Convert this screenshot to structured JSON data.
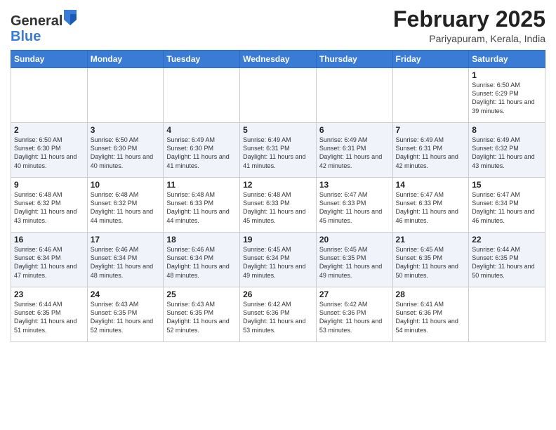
{
  "logo": {
    "general": "General",
    "blue": "Blue"
  },
  "header": {
    "month": "February 2025",
    "location": "Pariyapuram, Kerala, India"
  },
  "weekdays": [
    "Sunday",
    "Monday",
    "Tuesday",
    "Wednesday",
    "Thursday",
    "Friday",
    "Saturday"
  ],
  "weeks": [
    [
      {
        "day": "",
        "sunrise": "",
        "sunset": "",
        "daylight": ""
      },
      {
        "day": "",
        "sunrise": "",
        "sunset": "",
        "daylight": ""
      },
      {
        "day": "",
        "sunrise": "",
        "sunset": "",
        "daylight": ""
      },
      {
        "day": "",
        "sunrise": "",
        "sunset": "",
        "daylight": ""
      },
      {
        "day": "",
        "sunrise": "",
        "sunset": "",
        "daylight": ""
      },
      {
        "day": "",
        "sunrise": "",
        "sunset": "",
        "daylight": ""
      },
      {
        "day": "1",
        "sunrise": "Sunrise: 6:50 AM",
        "sunset": "Sunset: 6:29 PM",
        "daylight": "Daylight: 11 hours and 39 minutes."
      }
    ],
    [
      {
        "day": "2",
        "sunrise": "Sunrise: 6:50 AM",
        "sunset": "Sunset: 6:30 PM",
        "daylight": "Daylight: 11 hours and 40 minutes."
      },
      {
        "day": "3",
        "sunrise": "Sunrise: 6:50 AM",
        "sunset": "Sunset: 6:30 PM",
        "daylight": "Daylight: 11 hours and 40 minutes."
      },
      {
        "day": "4",
        "sunrise": "Sunrise: 6:49 AM",
        "sunset": "Sunset: 6:30 PM",
        "daylight": "Daylight: 11 hours and 41 minutes."
      },
      {
        "day": "5",
        "sunrise": "Sunrise: 6:49 AM",
        "sunset": "Sunset: 6:31 PM",
        "daylight": "Daylight: 11 hours and 41 minutes."
      },
      {
        "day": "6",
        "sunrise": "Sunrise: 6:49 AM",
        "sunset": "Sunset: 6:31 PM",
        "daylight": "Daylight: 11 hours and 42 minutes."
      },
      {
        "day": "7",
        "sunrise": "Sunrise: 6:49 AM",
        "sunset": "Sunset: 6:31 PM",
        "daylight": "Daylight: 11 hours and 42 minutes."
      },
      {
        "day": "8",
        "sunrise": "Sunrise: 6:49 AM",
        "sunset": "Sunset: 6:32 PM",
        "daylight": "Daylight: 11 hours and 43 minutes."
      }
    ],
    [
      {
        "day": "9",
        "sunrise": "Sunrise: 6:48 AM",
        "sunset": "Sunset: 6:32 PM",
        "daylight": "Daylight: 11 hours and 43 minutes."
      },
      {
        "day": "10",
        "sunrise": "Sunrise: 6:48 AM",
        "sunset": "Sunset: 6:32 PM",
        "daylight": "Daylight: 11 hours and 44 minutes."
      },
      {
        "day": "11",
        "sunrise": "Sunrise: 6:48 AM",
        "sunset": "Sunset: 6:33 PM",
        "daylight": "Daylight: 11 hours and 44 minutes."
      },
      {
        "day": "12",
        "sunrise": "Sunrise: 6:48 AM",
        "sunset": "Sunset: 6:33 PM",
        "daylight": "Daylight: 11 hours and 45 minutes."
      },
      {
        "day": "13",
        "sunrise": "Sunrise: 6:47 AM",
        "sunset": "Sunset: 6:33 PM",
        "daylight": "Daylight: 11 hours and 45 minutes."
      },
      {
        "day": "14",
        "sunrise": "Sunrise: 6:47 AM",
        "sunset": "Sunset: 6:33 PM",
        "daylight": "Daylight: 11 hours and 46 minutes."
      },
      {
        "day": "15",
        "sunrise": "Sunrise: 6:47 AM",
        "sunset": "Sunset: 6:34 PM",
        "daylight": "Daylight: 11 hours and 46 minutes."
      }
    ],
    [
      {
        "day": "16",
        "sunrise": "Sunrise: 6:46 AM",
        "sunset": "Sunset: 6:34 PM",
        "daylight": "Daylight: 11 hours and 47 minutes."
      },
      {
        "day": "17",
        "sunrise": "Sunrise: 6:46 AM",
        "sunset": "Sunset: 6:34 PM",
        "daylight": "Daylight: 11 hours and 48 minutes."
      },
      {
        "day": "18",
        "sunrise": "Sunrise: 6:46 AM",
        "sunset": "Sunset: 6:34 PM",
        "daylight": "Daylight: 11 hours and 48 minutes."
      },
      {
        "day": "19",
        "sunrise": "Sunrise: 6:45 AM",
        "sunset": "Sunset: 6:34 PM",
        "daylight": "Daylight: 11 hours and 49 minutes."
      },
      {
        "day": "20",
        "sunrise": "Sunrise: 6:45 AM",
        "sunset": "Sunset: 6:35 PM",
        "daylight": "Daylight: 11 hours and 49 minutes."
      },
      {
        "day": "21",
        "sunrise": "Sunrise: 6:45 AM",
        "sunset": "Sunset: 6:35 PM",
        "daylight": "Daylight: 11 hours and 50 minutes."
      },
      {
        "day": "22",
        "sunrise": "Sunrise: 6:44 AM",
        "sunset": "Sunset: 6:35 PM",
        "daylight": "Daylight: 11 hours and 50 minutes."
      }
    ],
    [
      {
        "day": "23",
        "sunrise": "Sunrise: 6:44 AM",
        "sunset": "Sunset: 6:35 PM",
        "daylight": "Daylight: 11 hours and 51 minutes."
      },
      {
        "day": "24",
        "sunrise": "Sunrise: 6:43 AM",
        "sunset": "Sunset: 6:35 PM",
        "daylight": "Daylight: 11 hours and 52 minutes."
      },
      {
        "day": "25",
        "sunrise": "Sunrise: 6:43 AM",
        "sunset": "Sunset: 6:35 PM",
        "daylight": "Daylight: 11 hours and 52 minutes."
      },
      {
        "day": "26",
        "sunrise": "Sunrise: 6:42 AM",
        "sunset": "Sunset: 6:36 PM",
        "daylight": "Daylight: 11 hours and 53 minutes."
      },
      {
        "day": "27",
        "sunrise": "Sunrise: 6:42 AM",
        "sunset": "Sunset: 6:36 PM",
        "daylight": "Daylight: 11 hours and 53 minutes."
      },
      {
        "day": "28",
        "sunrise": "Sunrise: 6:41 AM",
        "sunset": "Sunset: 6:36 PM",
        "daylight": "Daylight: 11 hours and 54 minutes."
      },
      {
        "day": "",
        "sunrise": "",
        "sunset": "",
        "daylight": ""
      }
    ]
  ]
}
